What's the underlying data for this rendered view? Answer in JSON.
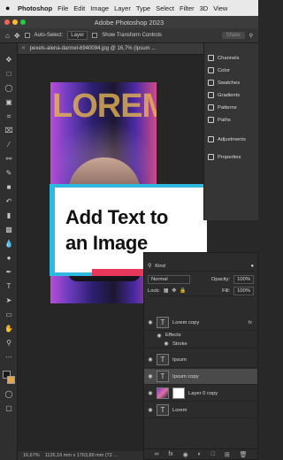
{
  "menubar": {
    "app": "Photoshop",
    "items": [
      "File",
      "Edit",
      "Image",
      "Layer",
      "Type",
      "Select",
      "Filter",
      "3D",
      "View"
    ]
  },
  "window": {
    "title": "Adobe Photoshop 2023"
  },
  "options_bar": {
    "auto_select_label": "Auto-Select:",
    "auto_select_value": "Layer",
    "show_transform_label": "Show Transform Controls",
    "share_label": "Share"
  },
  "document": {
    "tab_label": "pexels-alena-darmel-6940094.jpg @ 16,7% (Ipsum ...",
    "status_zoom": "16,67%",
    "status_size": "1126,16 mm x 1763,89 mm (72 ..."
  },
  "canvas": {
    "lorem_text": "LOREM",
    "card_line1": "Add Text to",
    "card_line2": "an Image"
  },
  "right_panel": {
    "items": [
      "Channels",
      "Color",
      "Swatches",
      "Gradients",
      "Patterns",
      "Paths",
      "Adjustments",
      "Properties"
    ]
  },
  "layers_panel": {
    "kind_label": "Kind",
    "blend_mode": "Normal",
    "opacity_label": "Opacity:",
    "opacity_value": "100%",
    "lock_label": "Lock:",
    "fill_label": "Fill:",
    "fill_value": "100%",
    "layers": [
      {
        "name": "Lorem copy",
        "type": "text",
        "fx": "fx"
      },
      {
        "name": "Effects",
        "type": "effects"
      },
      {
        "name": "Stroke",
        "type": "effect"
      },
      {
        "name": "Ipsum",
        "type": "text"
      },
      {
        "name": "Ipsum copy",
        "type": "text",
        "selected": true
      },
      {
        "name": "Layer 0 copy",
        "type": "image"
      },
      {
        "name": "Lorem",
        "type": "text"
      }
    ]
  },
  "colors": {
    "card_blue": "#2fb8e0",
    "card_pink": "#e9365b",
    "lorem_gold": "#e9b750",
    "foreground_swatch": "#1a1a1a",
    "background_swatch": "#e9a73a"
  }
}
